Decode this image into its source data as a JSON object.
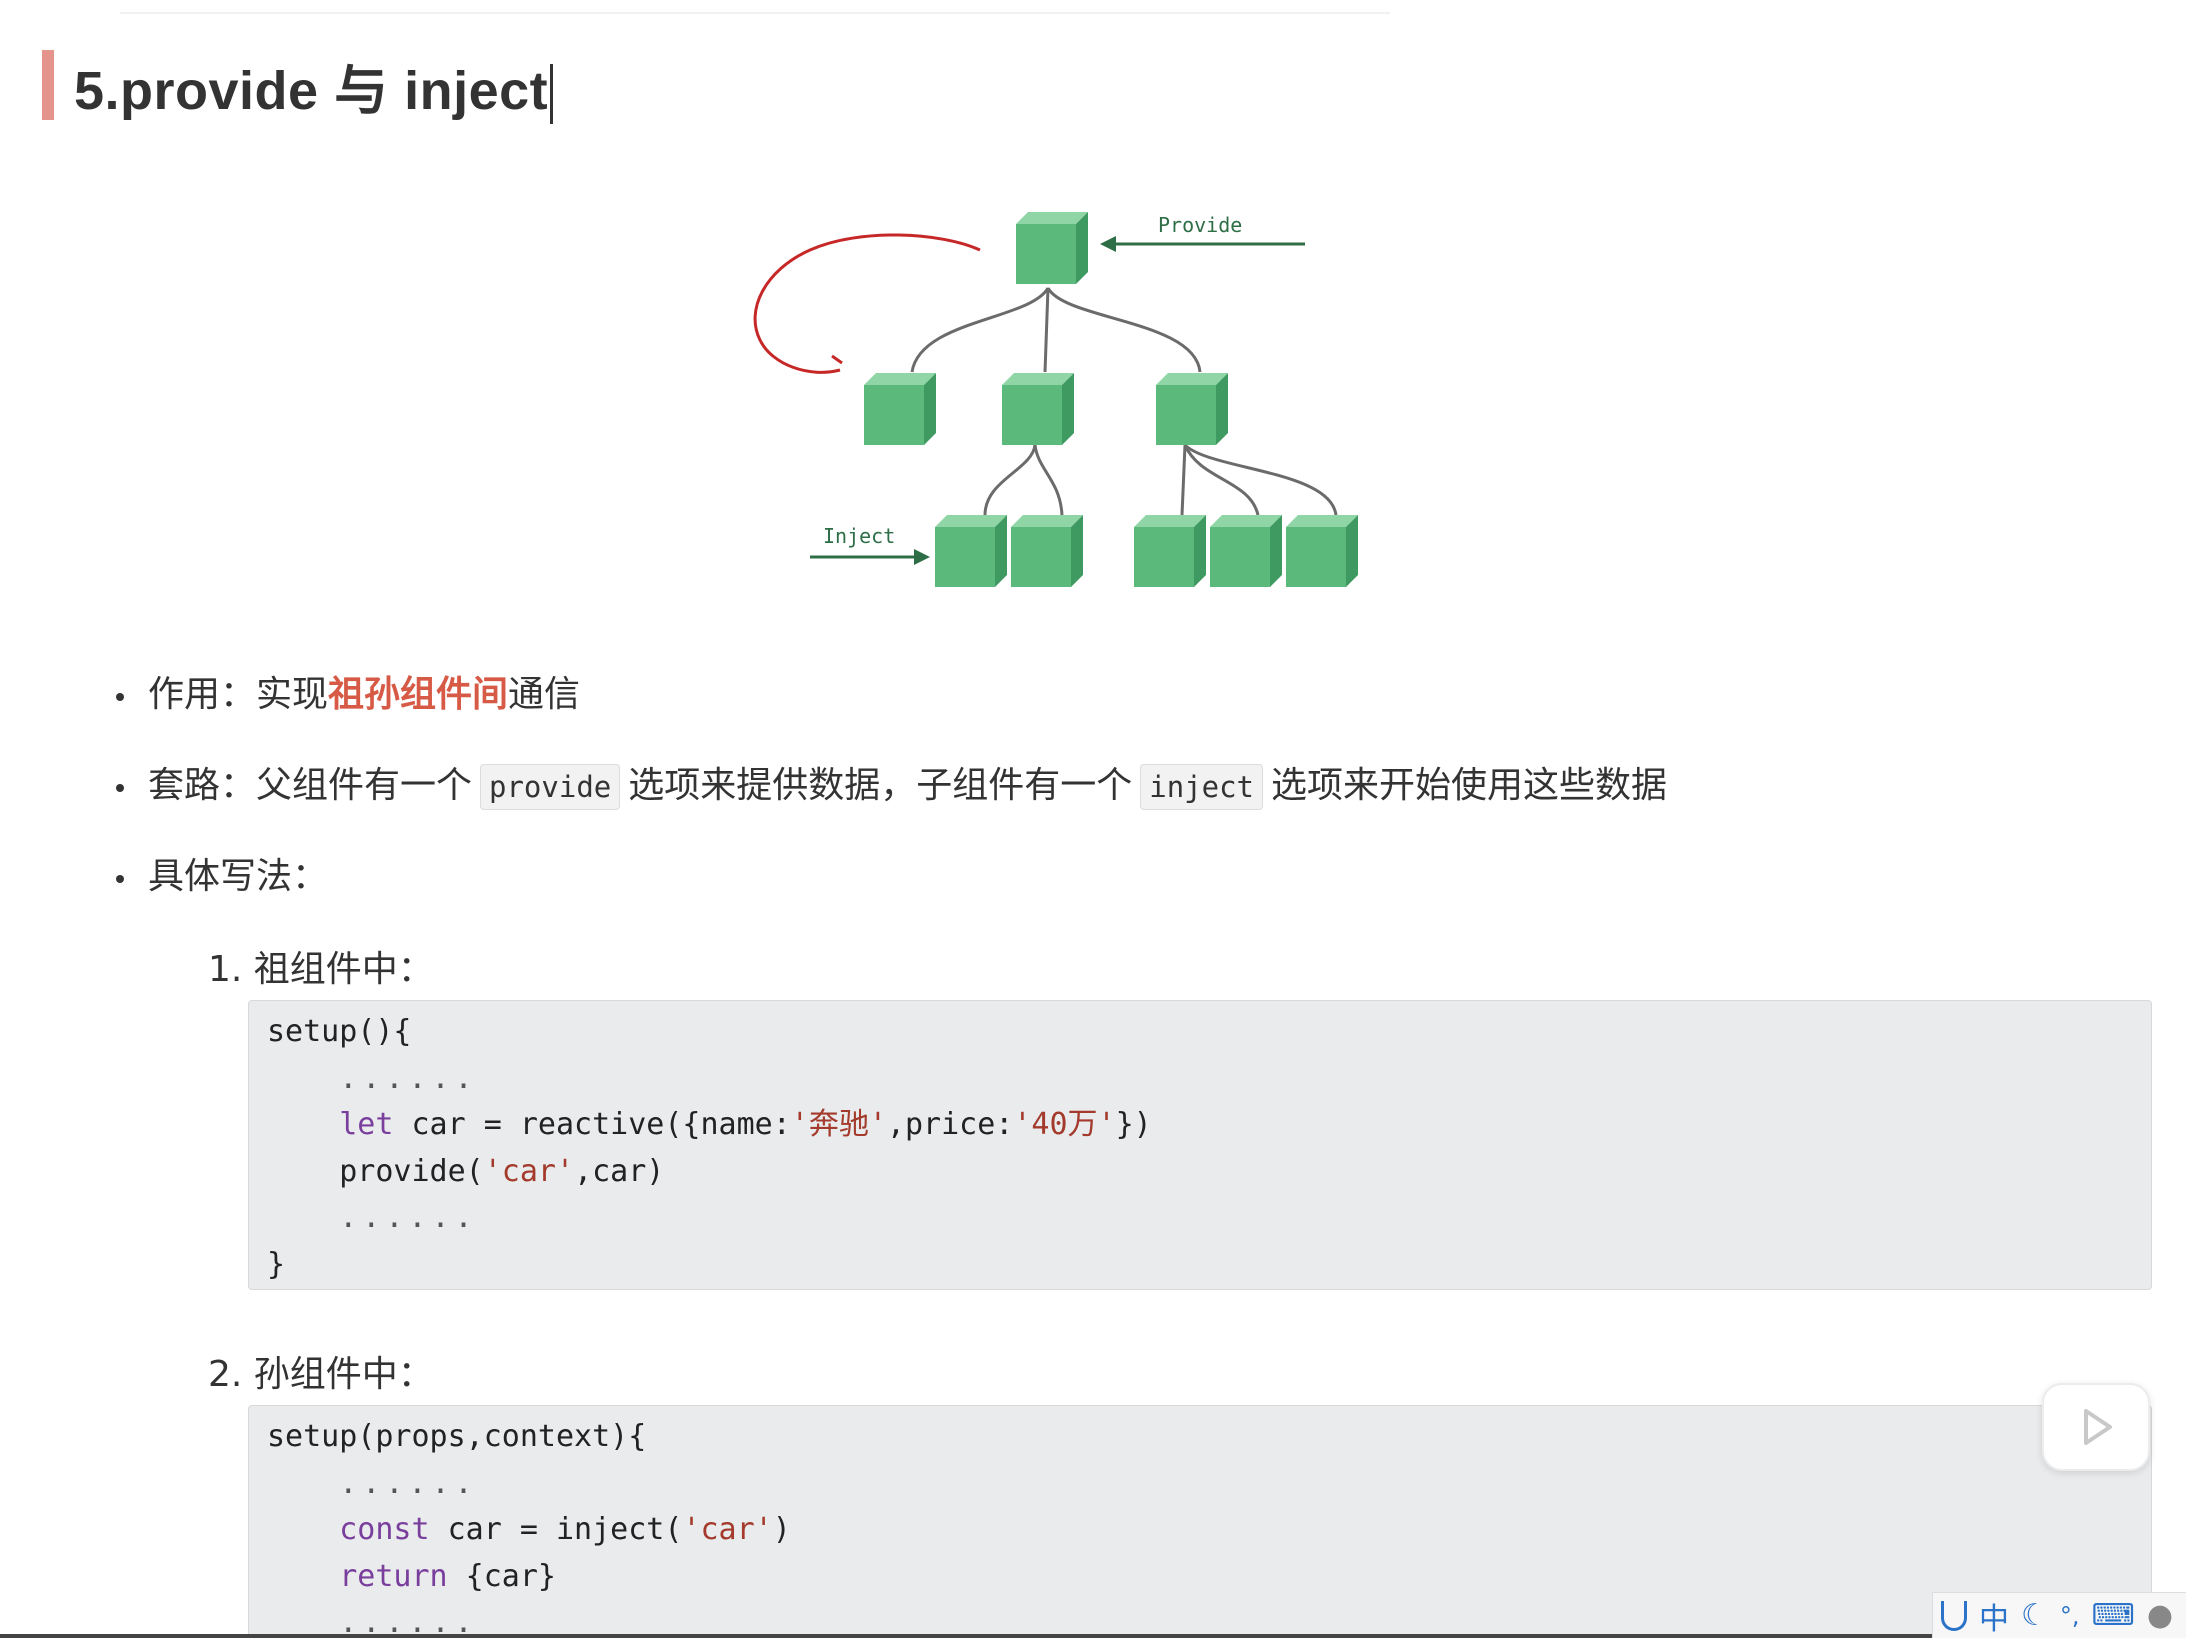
{
  "heading": {
    "title": "5.provide 与 inject"
  },
  "diagram": {
    "provide_label": "Provide",
    "inject_label": "Inject"
  },
  "bullets": [
    {
      "prefix": "作用：实现",
      "highlight": "祖孙组件间",
      "suffix": "通信"
    },
    {
      "t1": "套路：父组件有一个",
      "code1": "provide",
      "t2": "选项来提供数据，子组件有一个",
      "code2": "inject",
      "t3": "选项来开始使用这些数据"
    },
    {
      "text": "具体写法："
    }
  ],
  "steps": [
    {
      "label": "1. 祖组件中："
    },
    {
      "label": "2. 孙组件中："
    }
  ],
  "code1": {
    "l1": "setup(){",
    "l2": "......",
    "l3_kw": "let",
    "l3_a": " car = reactive({name:",
    "l3_s1": "'奔驰'",
    "l3_b": ",price:",
    "l3_s2": "'40万'",
    "l3_c": "})",
    "l4_a": "provide(",
    "l4_s": "'car'",
    "l4_b": ",car)",
    "l5": "......",
    "l6": "}"
  },
  "code2": {
    "l1": "setup(props,context){",
    "l2": "......",
    "l3_kw": "const",
    "l3_a": " car = inject(",
    "l3_s": "'car'",
    "l3_b": ")",
    "l4_kw": "return",
    "l4_a": " {car}",
    "l5": "......"
  },
  "colors": {
    "accent_bar": "#e4948a",
    "highlight": "#d65a45",
    "cube": "#5cb97c",
    "arrow": "#2e6e46",
    "scribble": "#c62828"
  },
  "icons": {
    "play": "play-icon"
  },
  "ime": {
    "lang": "中"
  }
}
